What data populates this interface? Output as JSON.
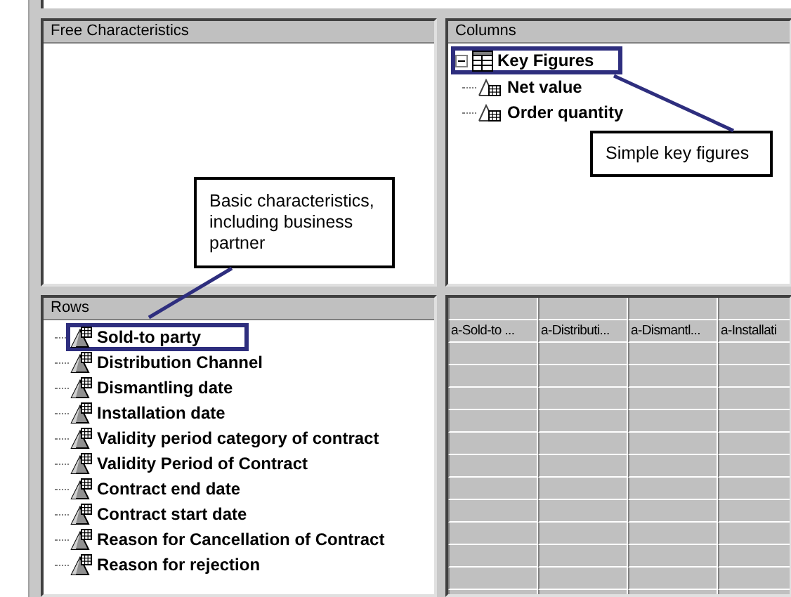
{
  "free_characteristics": {
    "title": "Free Characteristics"
  },
  "columns": {
    "title": "Columns",
    "tree": [
      {
        "label": "Key Figures",
        "expanded": true,
        "highlighted": true,
        "children": [
          {
            "label": "Net value",
            "highlighted": false
          },
          {
            "label": "Order quantity",
            "highlighted": false
          }
        ]
      }
    ]
  },
  "rows": {
    "title": "Rows",
    "items": [
      {
        "label": "Sold-to party",
        "highlighted": true
      },
      {
        "label": "Distribution Channel",
        "highlighted": false
      },
      {
        "label": "Dismantling date",
        "highlighted": false
      },
      {
        "label": "Installation date",
        "highlighted": false
      },
      {
        "label": "Validity period category of contract",
        "highlighted": false
      },
      {
        "label": "Validity Period of Contract",
        "highlighted": false
      },
      {
        "label": "Contract end date",
        "highlighted": false
      },
      {
        "label": "Contract start date",
        "highlighted": false
      },
      {
        "label": "Reason for Cancellation of Contract",
        "highlighted": false
      },
      {
        "label": "Reason for rejection",
        "highlighted": false
      }
    ]
  },
  "grid": {
    "columns": [
      "a-Sold-to ...",
      "a-Distributi...",
      "a-Dismantl...",
      "a-Installati"
    ]
  },
  "callouts": [
    {
      "text": "Basic characteristics, including business partner"
    },
    {
      "text": "Simple key figures"
    }
  ]
}
